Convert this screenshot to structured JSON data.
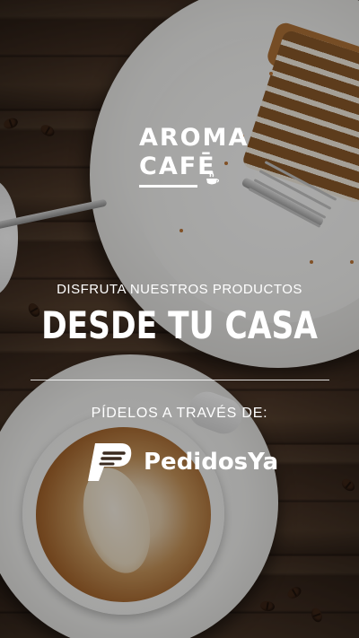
{
  "logo": {
    "line1": "AROMA",
    "line2": "CAFĒ",
    "icon": "coffee-cup-steam-icon"
  },
  "promo": {
    "subtitle": "DISFRUTA NUESTROS PRODUCTOS",
    "headline": "DESDE TU CASA",
    "cta": "PÍDELOS A TRAVÉS DE:"
  },
  "delivery_partner": {
    "name": "PedidosYa",
    "icon": "pedidosya-logo-icon"
  },
  "colors": {
    "text": "#ffffff",
    "overlay": "rgba(0,0,0,0.33)",
    "wood": "#4a3527"
  }
}
